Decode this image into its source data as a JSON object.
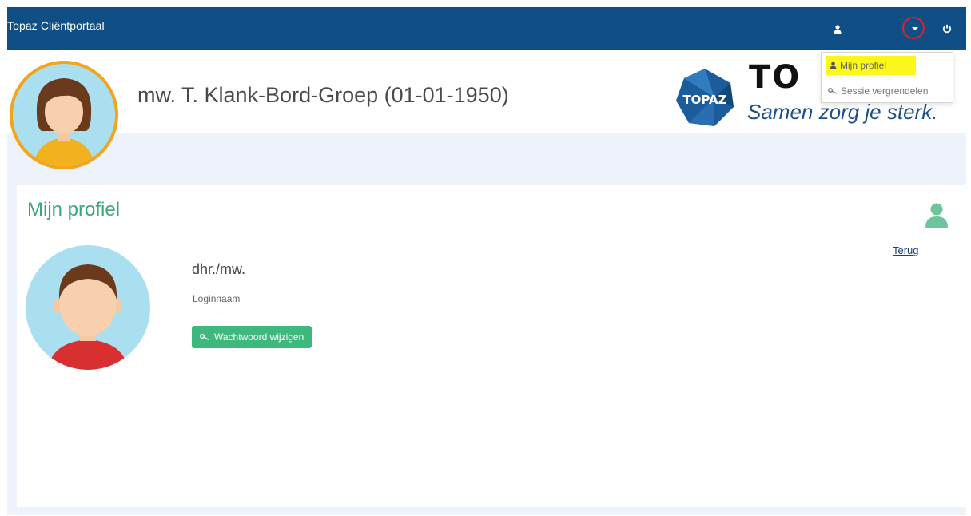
{
  "app": {
    "title": "Topaz Cliëntportaal"
  },
  "navbar": {
    "icons": [
      "user-icon",
      "caret-down-icon",
      "power-icon"
    ]
  },
  "dropdown": {
    "items": [
      {
        "label": "Mijn profiel",
        "icon": "user-icon",
        "highlight": "#fbf61b"
      },
      {
        "label": "Sessie vergrendelen",
        "icon": "key-icon"
      }
    ]
  },
  "header": {
    "client_name": "mw. T. Klank-Bord-Groep (01-01-1950)",
    "logo_text": "TO",
    "slogan": "Samen zorg je sterk."
  },
  "profile": {
    "title": "Mijn profiel",
    "back_link": "Terug",
    "salutation": "dhr./mw.",
    "login_label": "Loginnaam",
    "change_password_button": "Wachtwoord wijzigen"
  },
  "colors": {
    "navbar": "#0f4f86",
    "accent_green": "#3fb87e",
    "title_green": "#3aa87a",
    "avatar_ring": "#f2a51c",
    "highlight_circle": "#e0202a"
  }
}
